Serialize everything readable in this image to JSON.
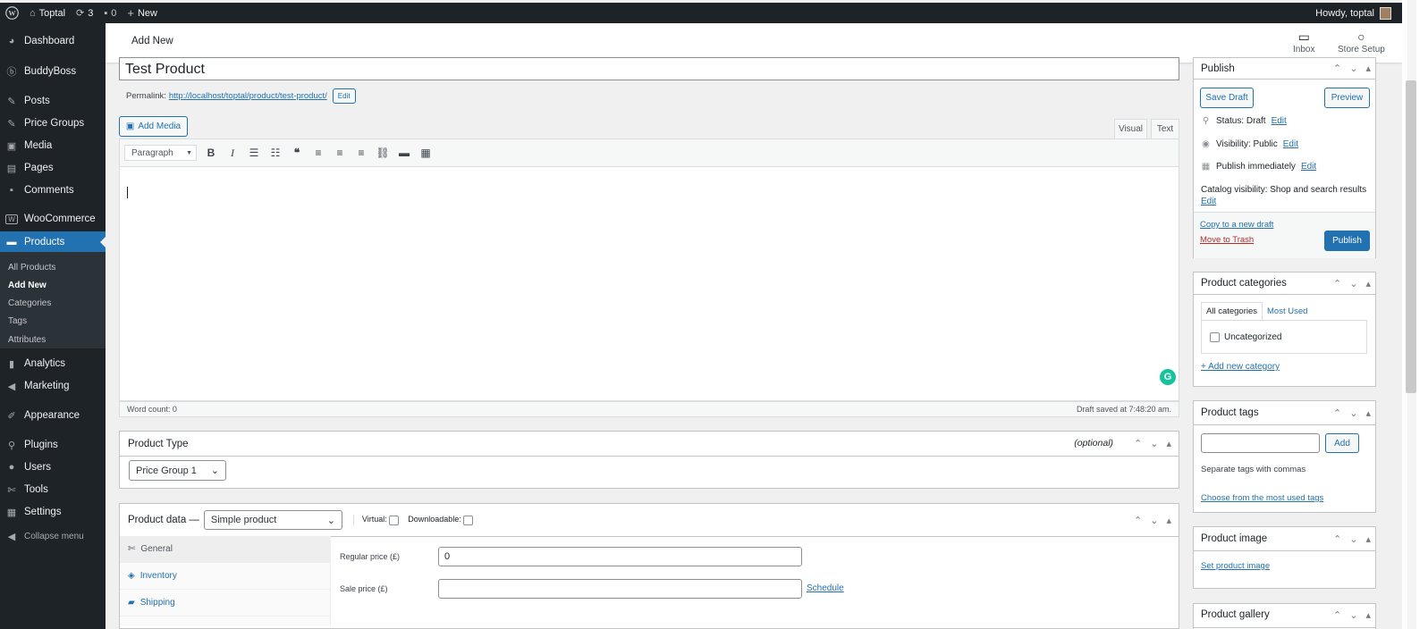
{
  "admin_bar": {
    "site_name": "Toptal",
    "updates_count": "3",
    "comments_count": "0",
    "new_label": "New",
    "howdy": "Howdy, toptal"
  },
  "sidebar": {
    "items": [
      {
        "label": "Dashboard",
        "icon": "dashboard-icon"
      },
      {
        "label": "BuddyBoss",
        "icon": "buddyboss-icon"
      },
      {
        "label": "Posts",
        "icon": "pin-icon"
      },
      {
        "label": "Price Groups",
        "icon": "pin-icon"
      },
      {
        "label": "Media",
        "icon": "media-icon"
      },
      {
        "label": "Pages",
        "icon": "pages-icon"
      },
      {
        "label": "Comments",
        "icon": "comment-icon"
      },
      {
        "label": "WooCommerce",
        "icon": "woo-icon"
      },
      {
        "label": "Products",
        "icon": "products-icon"
      },
      {
        "label": "Analytics",
        "icon": "analytics-icon"
      },
      {
        "label": "Marketing",
        "icon": "megaphone-icon"
      },
      {
        "label": "Appearance",
        "icon": "brush-icon"
      },
      {
        "label": "Plugins",
        "icon": "plug-icon"
      },
      {
        "label": "Users",
        "icon": "user-icon"
      },
      {
        "label": "Tools",
        "icon": "wrench-icon"
      },
      {
        "label": "Settings",
        "icon": "settings-icon"
      }
    ],
    "submenu": [
      "All Products",
      "Add New",
      "Categories",
      "Tags",
      "Attributes"
    ],
    "collapse_label": "Collapse menu"
  },
  "header": {
    "title": "Add New",
    "inbox_label": "Inbox",
    "store_setup_label": "Store Setup"
  },
  "post": {
    "title": "Test Product",
    "permalink_label": "Permalink:",
    "permalink_url": "http://localhost/toptal/product/test-product/",
    "edit_label": "Edit",
    "add_media_label": "Add Media",
    "tab_visual": "Visual",
    "tab_text": "Text",
    "format_value": "Paragraph",
    "word_count": "Word count: 0",
    "draft_saved": "Draft saved at 7:48:20 am."
  },
  "product_type": {
    "title": "Product Type",
    "optional": "(optional)",
    "value": "Price Group 1"
  },
  "product_data": {
    "title": "Product data —",
    "type_value": "Simple product",
    "virtual_label": "Virtual:",
    "downloadable_label": "Downloadable:",
    "tabs": [
      "General",
      "Inventory",
      "Shipping"
    ],
    "regular_price_label": "Regular price (£)",
    "regular_price_value": "0",
    "sale_price_label": "Sale price (£)",
    "sale_price_value": "",
    "schedule_label": "Schedule"
  },
  "publish": {
    "title": "Publish",
    "save_draft": "Save Draft",
    "preview": "Preview",
    "status_text": "Status: Draft",
    "visibility_text": "Visibility: Public",
    "publish_time": "Publish immediately",
    "edit": "Edit",
    "catalog_visibility": "Catalog visibility: Shop and search results",
    "copy_draft": "Copy to a new draft",
    "trash": "Move to Trash",
    "publish_button": "Publish"
  },
  "categories": {
    "title": "Product categories",
    "tab_all": "All categories",
    "tab_used": "Most Used",
    "item": "Uncategorized",
    "add_new": "+ Add new category"
  },
  "tags": {
    "title": "Product tags",
    "add_button": "Add",
    "hint": "Separate tags with commas",
    "choose": "Choose from the most used tags"
  },
  "image": {
    "title": "Product image",
    "set": "Set product image"
  },
  "gallery": {
    "title": "Product gallery"
  }
}
